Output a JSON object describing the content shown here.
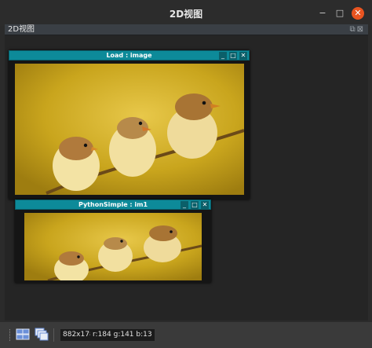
{
  "window": {
    "title": "2D视图",
    "minimize_glyph": "−",
    "maximize_glyph": "□",
    "close_glyph": "✕"
  },
  "panel": {
    "label": "2D视图",
    "icons": "⧉⊠"
  },
  "subwindows": [
    {
      "title": "Load : image",
      "buttons": [
        "_",
        "□",
        "✕"
      ]
    },
    {
      "title": "PythonSimple : im1",
      "buttons": [
        "_",
        "□",
        "✕"
      ]
    }
  ],
  "statusbar": {
    "size": "882x178",
    "rgb": "r:184 g:141 b:13"
  },
  "icons": {
    "tile": "tile-windows-icon",
    "cascade": "cascade-windows-icon"
  },
  "colors": {
    "titlebar_accent": "#0d8a99",
    "close": "#e95420",
    "image_bg": "#c9a51d"
  }
}
